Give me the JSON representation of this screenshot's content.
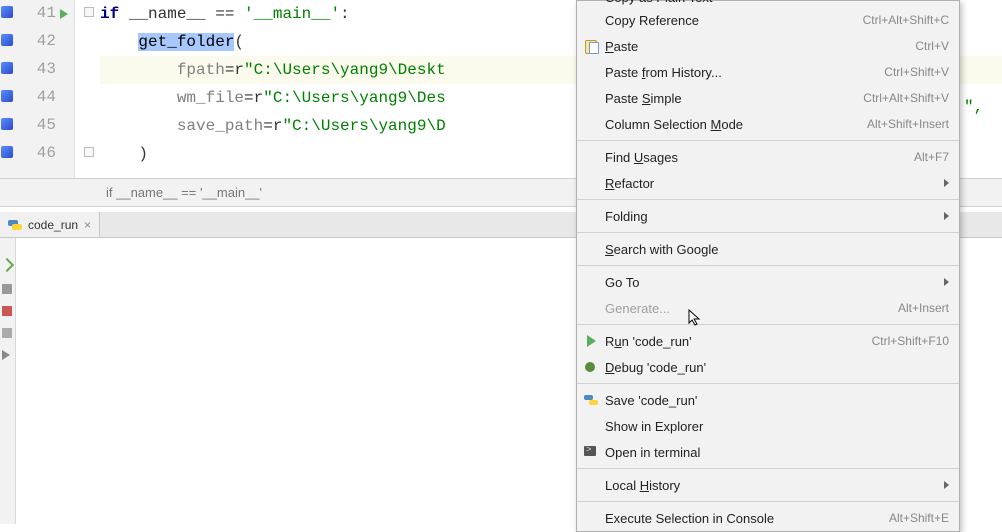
{
  "gutter": {
    "lines": [
      "41",
      "42",
      "43",
      "44",
      "45",
      "46"
    ]
  },
  "code": {
    "l41_kw": "if",
    "l41_name": "__name__",
    "l41_eq": " == ",
    "l41_str": "'__main__'",
    "l41_colon": ":",
    "l42_indent": "    ",
    "l42_fn": "get_folder",
    "l42_paren": "(",
    "l43_indent": "        ",
    "l43_kw": "fpath",
    "l43_eq": "=r",
    "l43_str": "\"C:\\Users\\yang9\\Deskt",
    "l44_indent": "        ",
    "l44_kw": "wm_file",
    "l44_eq": "=r",
    "l44_str": "\"C:\\Users\\yang9\\Des",
    "l45_indent": "        ",
    "l45_kw": "save_path",
    "l45_eq": "=r",
    "l45_str": "\"C:\\Users\\yang9\\D",
    "l46_indent": "    ",
    "l46_paren": ")"
  },
  "breadcrumb": "if __name__ == '__main__'",
  "tab": {
    "label": "code_run",
    "close": "×"
  },
  "right_frag": "\",",
  "menu": {
    "copy_plain": "Copy as Plain Text",
    "copy_ref": "Copy Reference",
    "copy_ref_sc": "Ctrl+Alt+Shift+C",
    "paste": "Paste",
    "paste_u": "P",
    "paste_sc": "Ctrl+V",
    "paste_hist": "Paste from History...",
    "paste_hist_u": "f",
    "paste_hist_sc": "Ctrl+Shift+V",
    "paste_simple": "Paste Simple",
    "paste_simple_u": "S",
    "paste_simple_sc": "Ctrl+Alt+Shift+V",
    "col_sel": "Column Selection Mode",
    "col_sel_u": "M",
    "col_sel_sc": "Alt+Shift+Insert",
    "find_usages": "Find Usages",
    "find_usages_u": "U",
    "find_usages_sc": "Alt+F7",
    "refactor": "Refactor",
    "refactor_u": "R",
    "folding": "Folding",
    "search_google": "Search with Google",
    "search_google_u": "S",
    "goto": "Go To",
    "generate": "Generate...",
    "generate_sc": "Alt+Insert",
    "run": "Run 'code_run'",
    "run_u": "u",
    "run_sc": "Ctrl+Shift+F10",
    "debug": "Debug 'code_run'",
    "debug_u": "D",
    "save": "Save 'code_run'",
    "explorer": "Show in Explorer",
    "terminal": "Open in terminal",
    "local_hist": "Local History",
    "local_hist_u": "H",
    "exec_sel": "Execute Selection in Console",
    "exec_sel_sc": "Alt+Shift+E"
  }
}
